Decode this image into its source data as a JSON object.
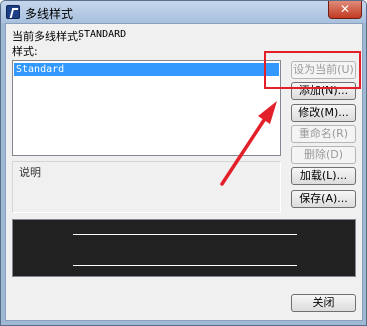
{
  "window": {
    "title": "多线样式",
    "close_glyph": "✕"
  },
  "current_style": {
    "label": "当前多线样式:",
    "value": "STANDARD"
  },
  "styles": {
    "label": "样式:",
    "items": [
      "Standard"
    ]
  },
  "description": {
    "label": "说明"
  },
  "buttons": {
    "set_current": "设为当前(U)",
    "add": "添加(N)...",
    "modify": "修改(M)...",
    "rename": "重命名(R)",
    "delete": "删除(D)",
    "load": "加载(L)...",
    "save": "保存(A)...",
    "close": "关闭"
  },
  "annotation": {
    "color": "#e3202a"
  }
}
